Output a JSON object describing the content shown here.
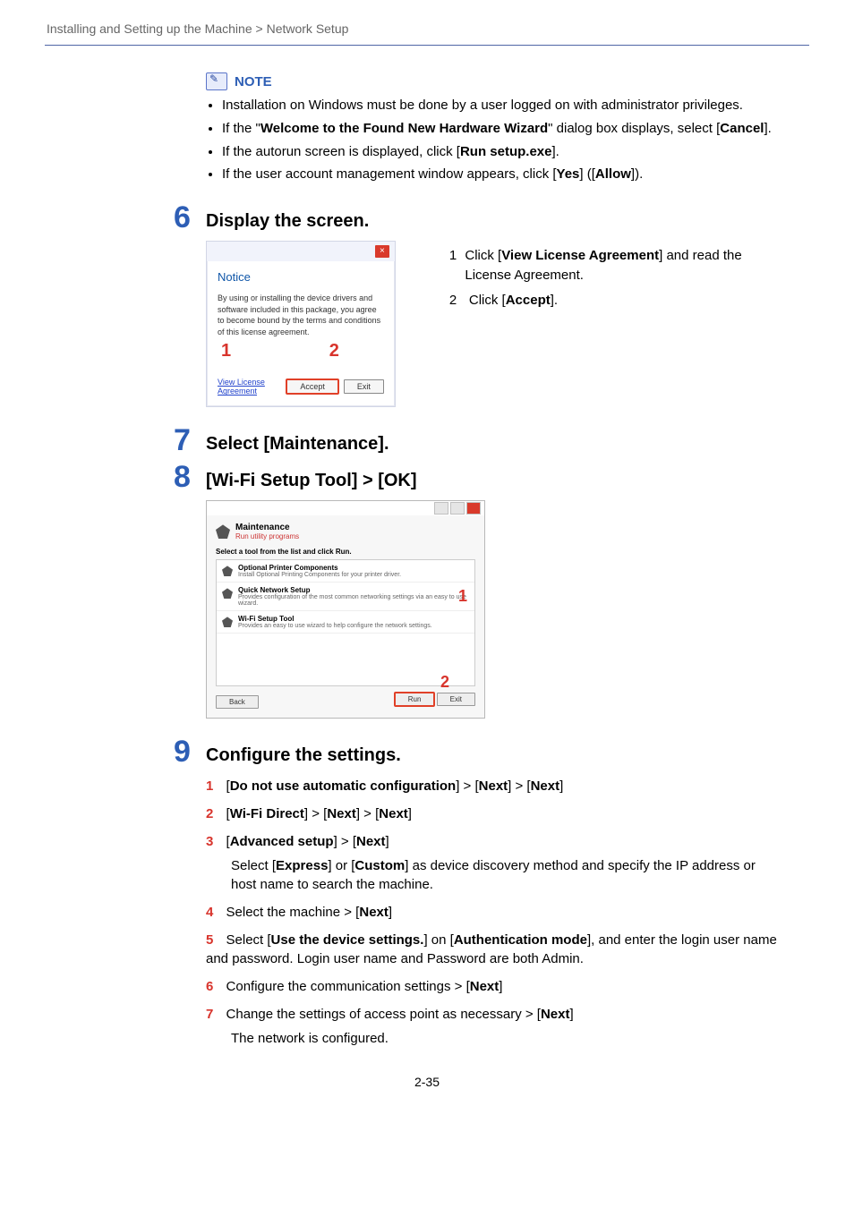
{
  "breadcrumb": {
    "chapter": "Installing and Setting up the Machine",
    "sep": ">",
    "section": "Network Setup"
  },
  "note": {
    "title": "NOTE",
    "items_text": {
      "i0": "Installation on Windows must be done by a user logged on with administrator privileges.",
      "i1a": "If the \"",
      "i1b": "Welcome to the Found New Hardware Wizard",
      "i1c": "\" dialog box displays, select [",
      "i1d": "Cancel",
      "i1e": "].",
      "i2a": "If the autorun screen is displayed, click [",
      "i2b": "Run setup.exe",
      "i2c": "].",
      "i3a": "If the user account management window appears, click [",
      "i3b": "Yes",
      "i3c": "] ([",
      "i3d": "Allow",
      "i3e": "])."
    }
  },
  "steps": {
    "s6": {
      "num": "6",
      "title": "Display the screen."
    },
    "s7": {
      "num": "7",
      "title": "Select [Maintenance]."
    },
    "s8": {
      "num": "8",
      "title": "[Wi-Fi Setup Tool] > [OK]"
    },
    "s9": {
      "num": "9",
      "title": "Configure the settings."
    }
  },
  "dialog1": {
    "title_gray": "                       ",
    "close": "×",
    "heading": "Notice",
    "msg": "By using or installing the device drivers and software included in this package, you agree to become bound by the terms and conditions of this license agreement.",
    "link": "View License Agreement",
    "accept": "Accept",
    "exit": "Exit",
    "marker1": "1",
    "marker2": "2"
  },
  "step6_right": {
    "r1n": "1",
    "r1a": "Click [",
    "r1b": "View License Agreement",
    "r1c": "] and read the License Agreement.",
    "r2n": "2",
    "r2a": "Click [",
    "r2b": "Accept",
    "r2c": "]."
  },
  "dialog2": {
    "h1": "Maintenance",
    "h2": "Run utility programs",
    "sub": "Select a tool from the list and click Run.",
    "rows": {
      "r0": {
        "t1": "Optional Printer Components",
        "t2": "Install Optional Printing Components for your printer driver."
      },
      "r1": {
        "t1": "Quick Network Setup",
        "t2": "Provides configuration of the most common networking settings via an easy to use wizard."
      },
      "r2": {
        "t1": "Wi-Fi Setup Tool",
        "t2": "Provides an easy to use wizard to help configure the network settings."
      }
    },
    "back": "Back",
    "run": "Run",
    "exit": "Exit",
    "m1": "1",
    "m2": "2"
  },
  "sub9": {
    "i1": {
      "n": "1",
      "a": "[",
      "b": "Do not use automatic configuration",
      "c": "] > [",
      "d": "Next",
      "e": "] > [",
      "f": "Next",
      "g": "]"
    },
    "i2": {
      "n": "2",
      "a": "[",
      "b": "Wi-Fi Direct",
      "c": "] > [",
      "d": "Next",
      "e": "] > [",
      "f": "Next",
      "g": "]"
    },
    "i3": {
      "n": "3",
      "a": "[",
      "b": "Advanced setup",
      "c": "] > [",
      "d": "Next",
      "e": "]",
      "desc1": "Select [",
      "desc2": "Express",
      "desc3": "] or [",
      "desc4": "Custom",
      "desc5": "] as device discovery method and specify the IP address or host name to search the machine."
    },
    "i4": {
      "n": "4",
      "a": "Select the machine > [",
      "b": "Next",
      "c": "]"
    },
    "i5": {
      "n": "5",
      "a": "Select [",
      "b": "Use the device settings.",
      "c": "] on [",
      "d": "Authentication mode",
      "e": "], and enter the login user name and password. Login user name and Password are both Admin."
    },
    "i6": {
      "n": "6",
      "a": "Configure the communication settings > [",
      "b": "Next",
      "c": "]"
    },
    "i7": {
      "n": "7",
      "a": "Change the settings of access point as necessary > [",
      "b": "Next",
      "c": "]",
      "desc": "The network is configured."
    }
  },
  "page_number": "2-35"
}
